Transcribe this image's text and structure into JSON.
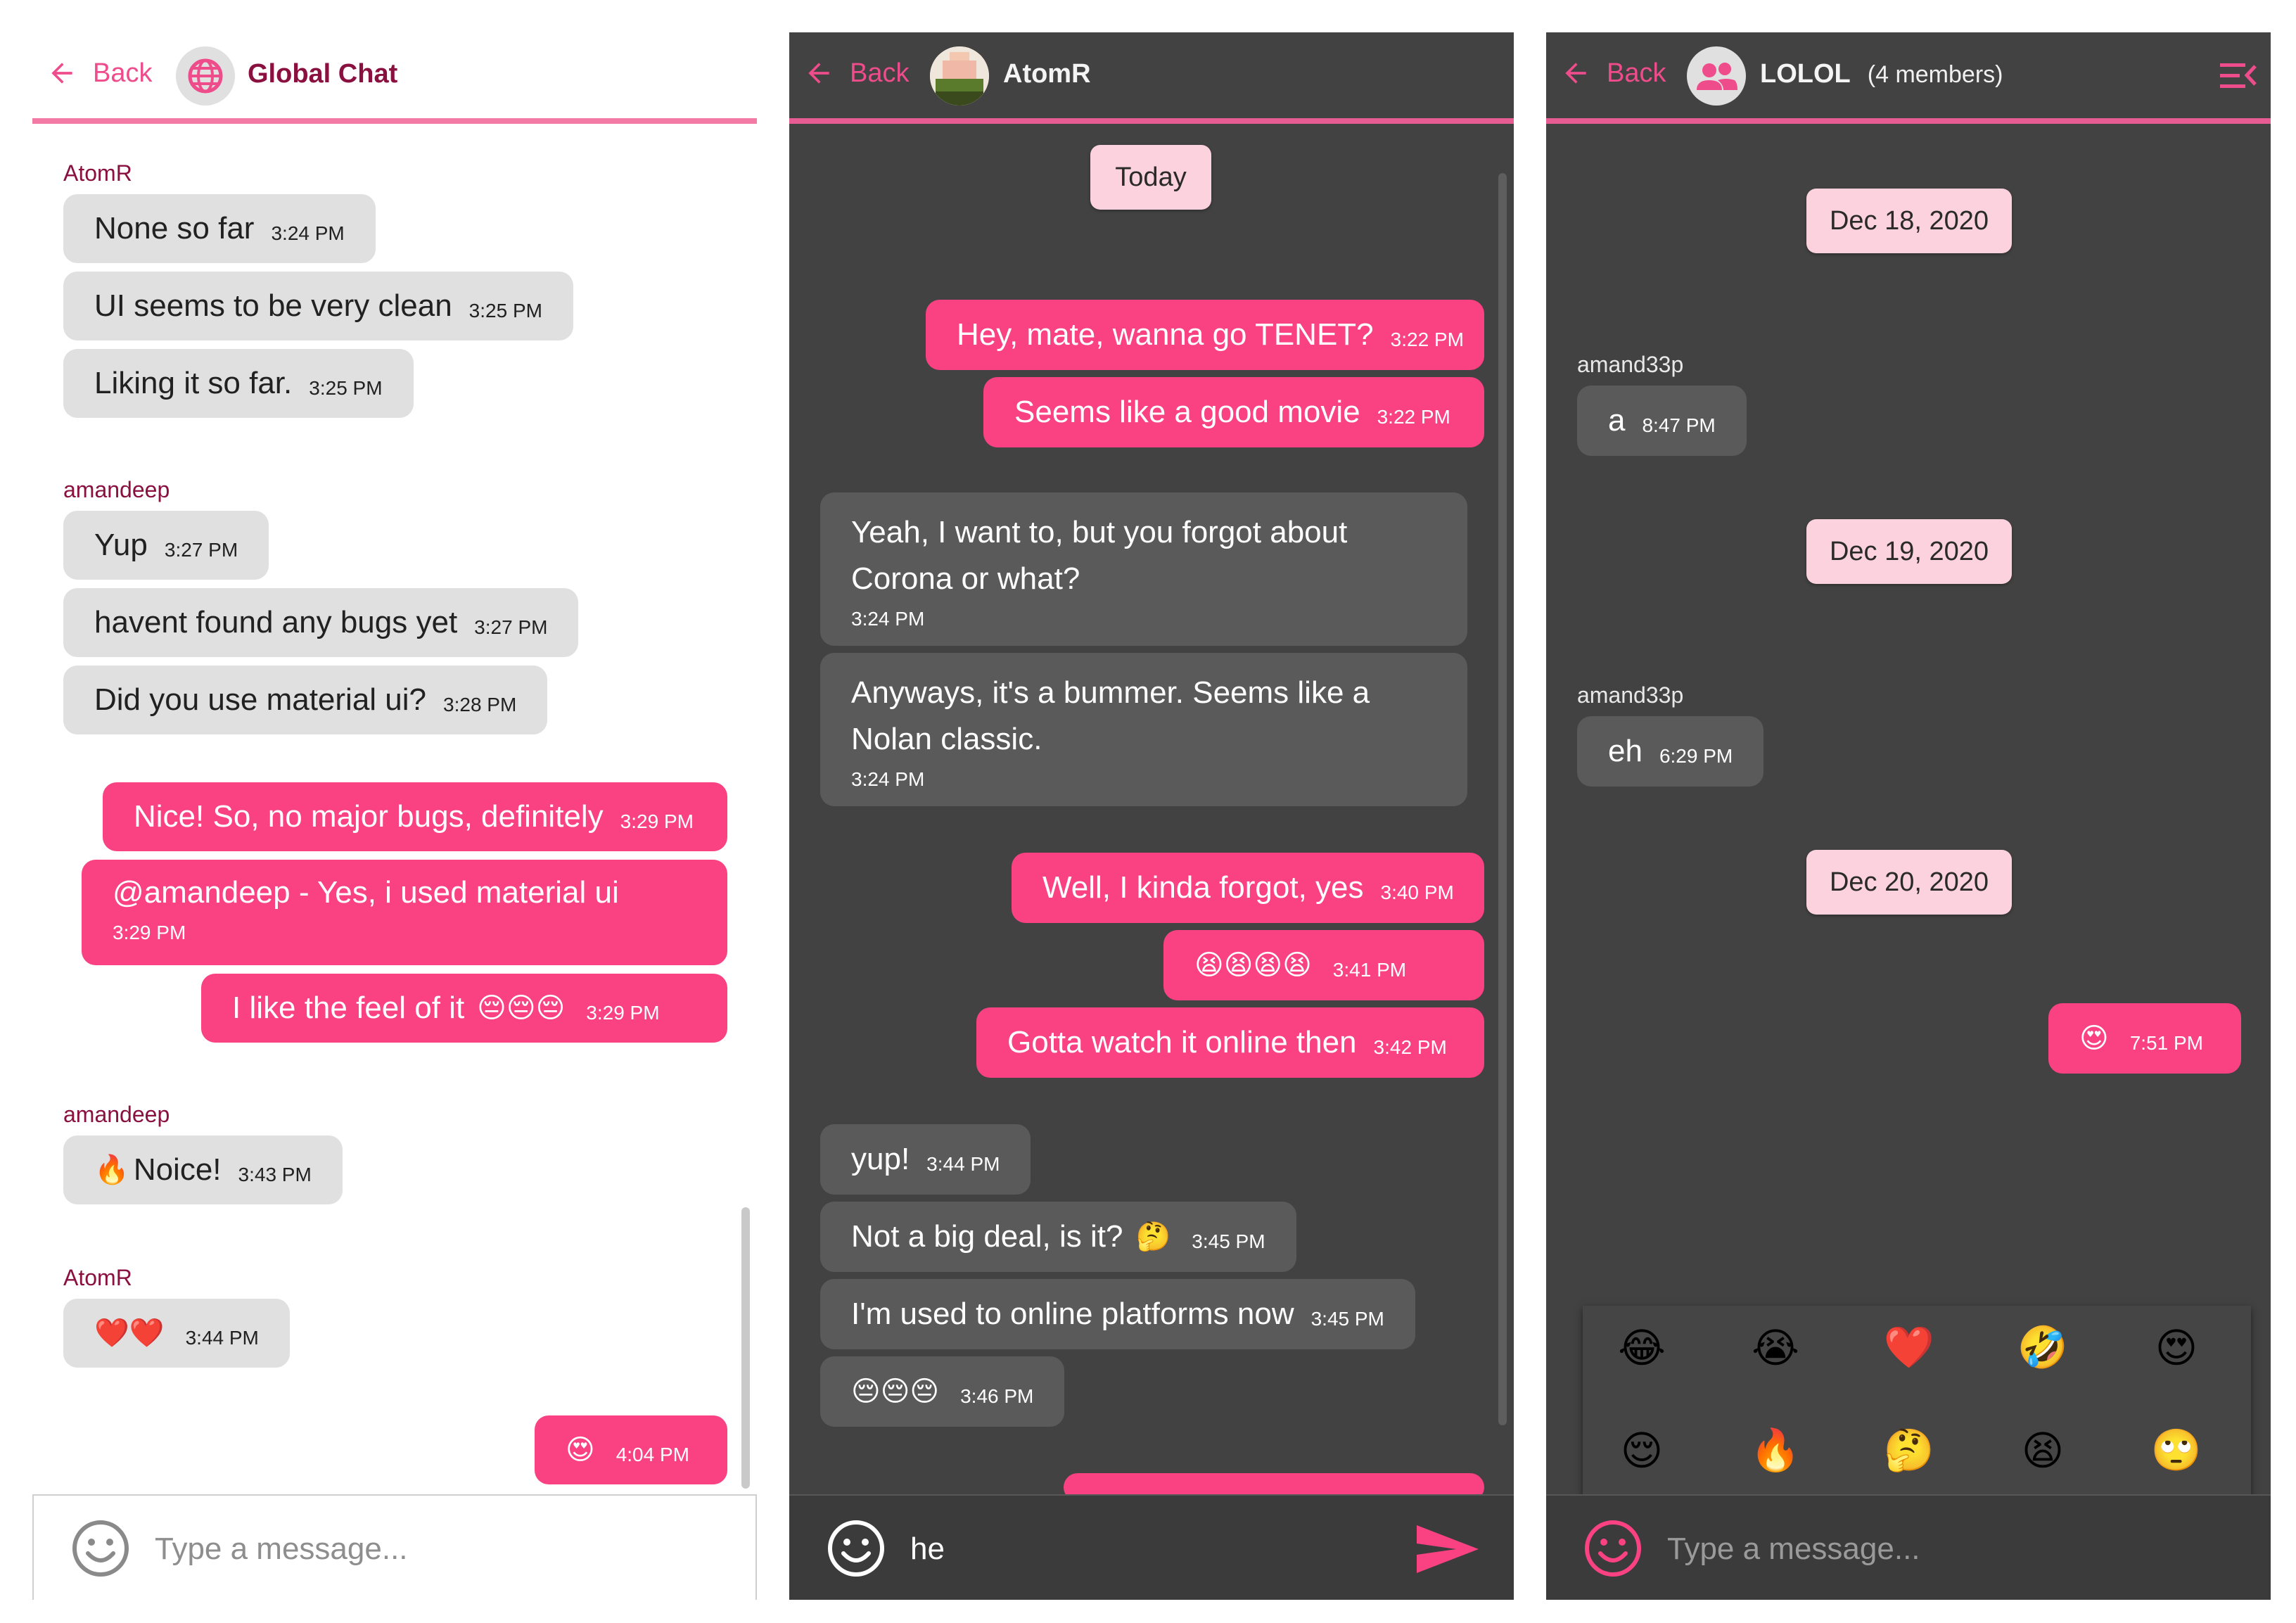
{
  "panel1": {
    "back_label": "Back",
    "title": "Global Chat",
    "avatar_icon": "globe-icon",
    "input_placeholder": "Type a message...",
    "messages": [
      {
        "sender": "AtomR"
      },
      {
        "text": "None so far",
        "time": "3:24 PM"
      },
      {
        "text": "UI seems to be very clean",
        "time": "3:25 PM"
      },
      {
        "text": "Liking it so far.",
        "time": "3:25 PM"
      },
      {
        "sender": "amandeep"
      },
      {
        "text": "Yup",
        "time": "3:27 PM"
      },
      {
        "text": "havent found any bugs yet",
        "time": "3:27 PM"
      },
      {
        "text": "Did you use material ui?",
        "time": "3:28 PM"
      },
      {
        "text": "Nice! So, no major bugs, definitely",
        "time": "3:29 PM"
      },
      {
        "text": "@amandeep - Yes, i used material ui",
        "time": "3:29 PM"
      },
      {
        "text": "I like the feel of it",
        "emoji": "😔😔😔",
        "time": "3:29 PM"
      },
      {
        "sender": "amandeep"
      },
      {
        "emoji": "🔥",
        "text": "Noice!",
        "time": "3:43 PM"
      },
      {
        "sender": "AtomR"
      },
      {
        "emoji": "❤️❤️",
        "time": "3:44 PM"
      },
      {
        "emoji": "😍",
        "time": "4:04 PM"
      }
    ]
  },
  "panel2": {
    "back_label": "Back",
    "title": "AtomR",
    "date_chip": "Today",
    "input_value": "he",
    "messages": [
      {
        "text": "Hey, mate, wanna go TENET?",
        "time": "3:22 PM"
      },
      {
        "text": "Seems like a good movie",
        "time": "3:22 PM"
      },
      {
        "text": "Yeah, I want to, but you forgot about Corona or what?",
        "time": "3:24 PM"
      },
      {
        "text": "Anyways, it's a bummer. Seems like a Nolan classic.",
        "time": "3:24 PM"
      },
      {
        "text": "Well, I kinda forgot, yes",
        "time": "3:40 PM"
      },
      {
        "emoji": "😫😫😫😫",
        "time": "3:41 PM"
      },
      {
        "text": "Gotta watch it online then",
        "time": "3:42 PM"
      },
      {
        "text": "yup!",
        "time": "3:44 PM"
      },
      {
        "text": "Not a big deal, is it?",
        "emoji": "🤔",
        "time": "3:45 PM"
      },
      {
        "text": "I'm used to online platforms now",
        "time": "3:45 PM"
      },
      {
        "emoji": "😔😔😔",
        "time": "3:46 PM"
      }
    ]
  },
  "panel3": {
    "back_label": "Back",
    "title": "LOLOL",
    "members": "(4 members)",
    "input_placeholder": "Type a message...",
    "dates": [
      "Dec 18, 2020",
      "Dec 19, 2020",
      "Dec 20, 2020"
    ],
    "messages": [
      {
        "sender": "amand33p"
      },
      {
        "text": "a",
        "time": "8:47 PM"
      },
      {
        "sender": "amand33p"
      },
      {
        "text": "eh",
        "time": "6:29 PM"
      },
      {
        "emoji": "😍",
        "time": "7:51 PM"
      }
    ],
    "emoji_picker": [
      "😂",
      "😭",
      "❤️",
      "🤣",
      "😍",
      "😌",
      "🔥",
      "🤔",
      "😫",
      "🙄"
    ]
  },
  "colors": {
    "accent_pink": "#fa4182",
    "header_line": "#f37aa5",
    "dark_bg": "#424242",
    "date_chip": "#fbd2de"
  }
}
